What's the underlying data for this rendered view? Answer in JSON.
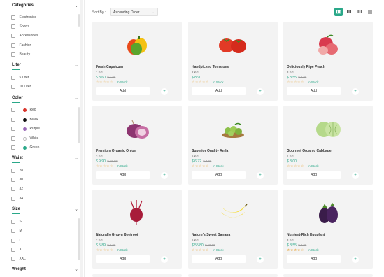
{
  "filters": {
    "categories": {
      "title": "Categories",
      "items": [
        "Electronics",
        "Sports",
        "Accessories",
        "Fashion",
        "Beauty"
      ]
    },
    "liter": {
      "title": "Liter",
      "items": [
        "5 Liter",
        "10 Liter"
      ]
    },
    "color": {
      "title": "Color",
      "items": [
        {
          "label": "Red",
          "color": "#d9342b"
        },
        {
          "label": "Black",
          "color": "#111111"
        },
        {
          "label": "Purple",
          "color": "#9b6ab8"
        },
        {
          "label": "White",
          "color": "#ffffff"
        },
        {
          "label": "Green",
          "color": "#2aa889"
        }
      ]
    },
    "waist": {
      "title": "Waist",
      "items": [
        "28",
        "30",
        "32",
        "34"
      ]
    },
    "size": {
      "title": "Size",
      "items": [
        "S",
        "M",
        "L",
        "XL",
        "XXL"
      ]
    },
    "weight": {
      "title": "Weight"
    }
  },
  "toolbar": {
    "sort_label": "Sort By :",
    "sort_value": "Ascending Order",
    "sort_arrow": "⌄"
  },
  "view_icons": [
    "grid-4-icon",
    "grid-3-icon",
    "grid-2-icon",
    "list-icon"
  ],
  "products": [
    {
      "name": "Fresh Capsicum",
      "weight": "1 KG",
      "price": "$ 3.60",
      "old_price": "$ 4.00",
      "rating": 0,
      "stock": "In Stock",
      "add": "Add",
      "plus": "+",
      "icon": "capsicum-icon"
    },
    {
      "name": "Handpicked Tomatoes",
      "weight": "2 KG",
      "price": "$ 8.90",
      "old_price": "",
      "rating": 0,
      "stock": "In Stock",
      "add": "Add",
      "plus": "+",
      "icon": "tomato-icon"
    },
    {
      "name": "Deliciously Ripe Peach",
      "weight": "3 KG",
      "price": "$ 8.55",
      "old_price": "$ 9.00",
      "rating": 0,
      "stock": "In Stock",
      "add": "Add",
      "plus": "+",
      "icon": "peach-icon"
    },
    {
      "name": "Premium Organic Onion",
      "weight": "3 KG",
      "price": "$ 9.90",
      "old_price": "$ 10.00",
      "rating": 0,
      "stock": "In Stock",
      "add": "Add",
      "plus": "+",
      "icon": "onion-icon"
    },
    {
      "name": "Superior Quality Amla",
      "weight": "5 KG",
      "price": "$ 6.72",
      "old_price": "$ 7.00",
      "rating": 0,
      "stock": "In Stock",
      "add": "Add",
      "plus": "+",
      "icon": "amla-icon"
    },
    {
      "name": "Gourmet Organic Cabbage",
      "weight": "1 KG",
      "price": "$ 3.00",
      "old_price": "",
      "rating": 0,
      "stock": "In Stock",
      "add": "Add",
      "plus": "+",
      "icon": "cabbage-icon"
    },
    {
      "name": "Naturally Grown Beetroot",
      "weight": "2 KG",
      "price": "$ 5.89",
      "old_price": "$ 6.00",
      "rating": 0,
      "stock": "In Stock",
      "add": "Add",
      "plus": "+",
      "icon": "beetroot-icon"
    },
    {
      "name": "Nature's Sweet Banana",
      "weight": "6 KG",
      "price": "$ 55.80",
      "old_price": "$ 60.00",
      "rating": 0,
      "stock": "In Stock",
      "add": "Add",
      "plus": "+",
      "icon": "banana-icon"
    },
    {
      "name": "Nutrient-Rich Eggplant",
      "weight": "3 KG",
      "price": "$ 8.55",
      "old_price": "$ 9.00",
      "rating": 4,
      "stock": "In Stock",
      "add": "Add",
      "plus": "+",
      "icon": "eggplant-icon"
    }
  ],
  "accent": "#2aa889",
  "star_color": "#e6a63a"
}
